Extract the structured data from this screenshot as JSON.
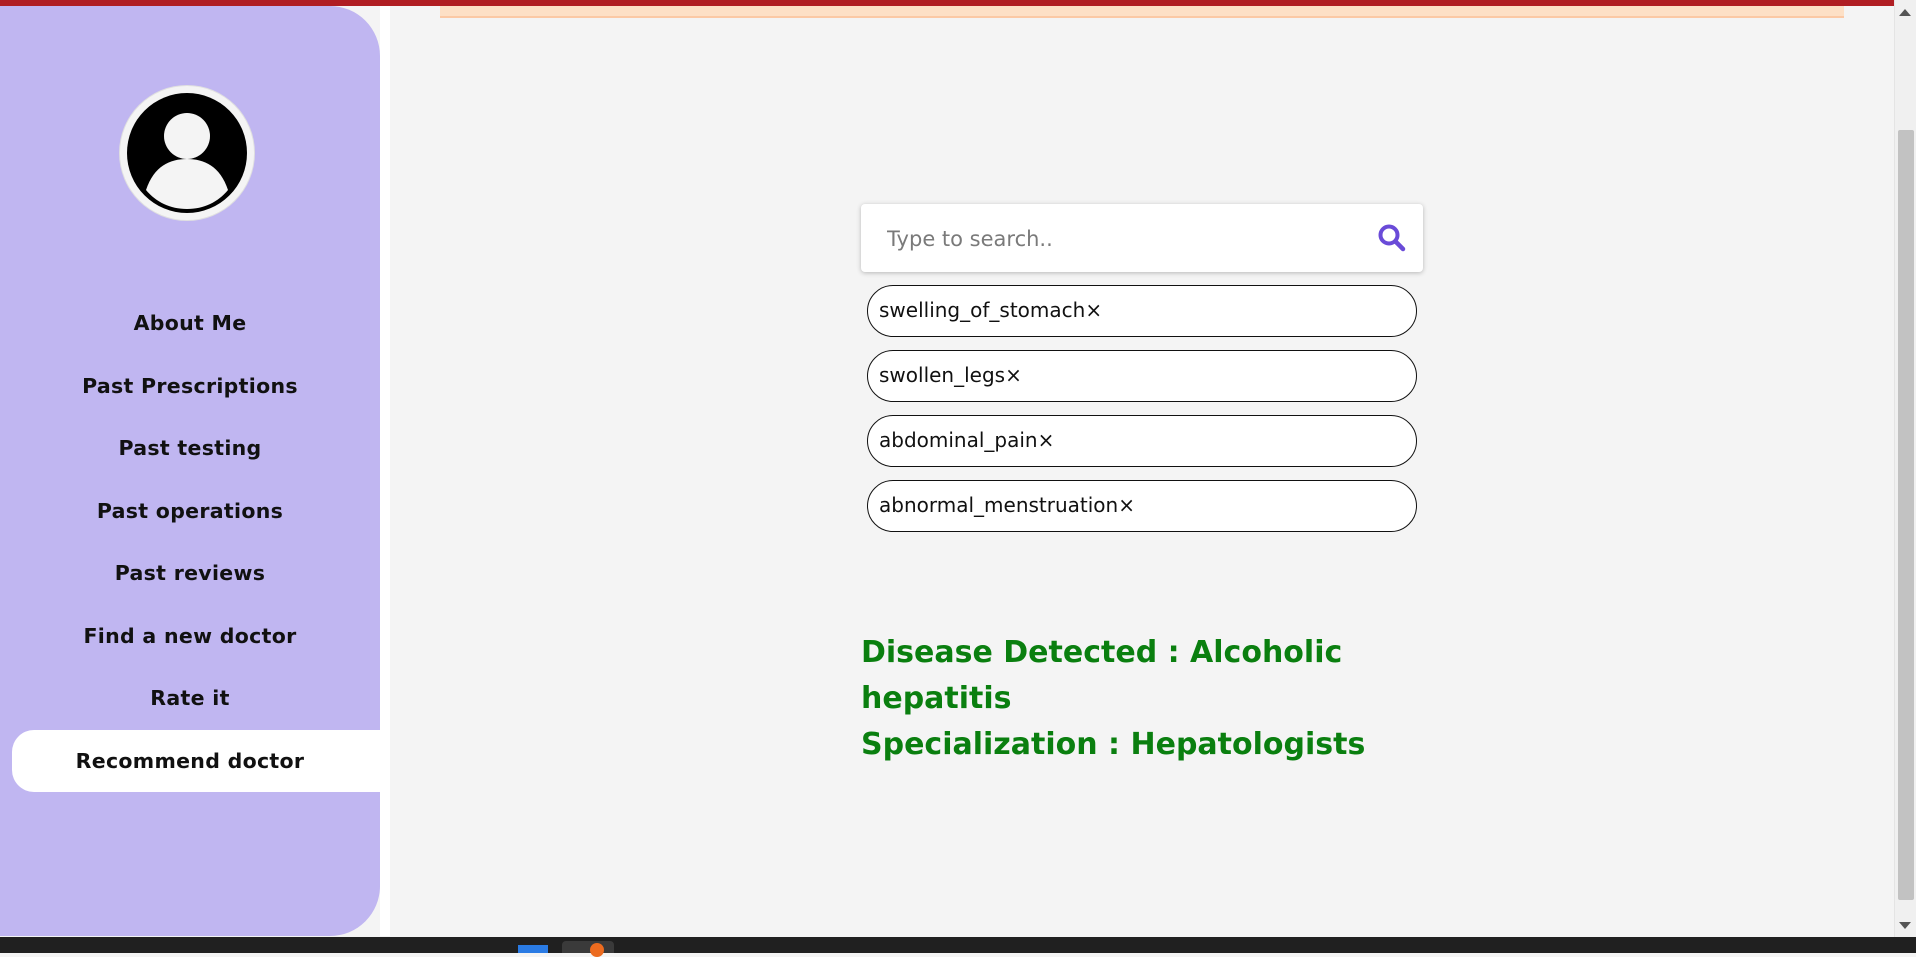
{
  "sidebar": {
    "avatar_label": "profile-avatar",
    "items": [
      {
        "label": "About Me",
        "active": false
      },
      {
        "label": "Past Prescriptions",
        "active": false
      },
      {
        "label": "Past testing",
        "active": false
      },
      {
        "label": "Past operations",
        "active": false
      },
      {
        "label": "Past reviews",
        "active": false
      },
      {
        "label": "Find a new doctor",
        "active": false
      },
      {
        "label": "Rate it",
        "active": false
      },
      {
        "label": "Recommend doctor",
        "active": true
      }
    ]
  },
  "search": {
    "placeholder": "Type to search..",
    "value": "",
    "icon": "search-icon"
  },
  "tags": [
    {
      "text": "swelling_of_stomach",
      "remove": "×"
    },
    {
      "text": "swollen_legs",
      "remove": "×"
    },
    {
      "text": "abdominal_pain",
      "remove": "×"
    },
    {
      "text": "abnormal_menstruation",
      "remove": "×"
    }
  ],
  "result": {
    "disease_line": "Disease Detected : Alcoholic hepatitis",
    "specialization_line": "Specialization : Hepatologists"
  },
  "colors": {
    "sidebar_bg": "#c0b6f1",
    "accent": "#6a4bd8",
    "result_text": "#0a7f0f",
    "top_bar": "#b01e23"
  }
}
